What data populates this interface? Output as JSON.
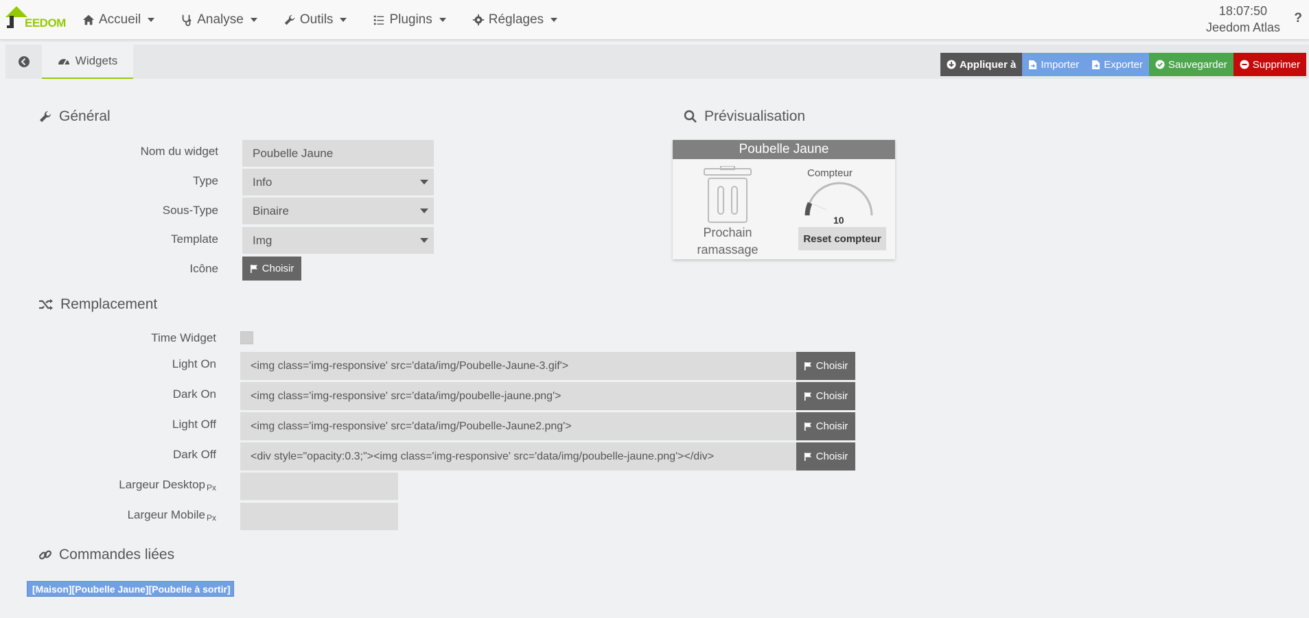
{
  "navbar": {
    "logo_text": "EEDOM",
    "menu": [
      {
        "label": "Accueil",
        "icon": "home-icon"
      },
      {
        "label": "Analyse",
        "icon": "stethoscope-icon"
      },
      {
        "label": "Outils",
        "icon": "wrench-icon"
      },
      {
        "label": "Plugins",
        "icon": "tasks-icon"
      },
      {
        "label": "Réglages",
        "icon": "gear-icon"
      }
    ],
    "clock": "18:07:50",
    "system_name": "Jeedom Atlas",
    "help": "?"
  },
  "tabs": {
    "active_label": "Widgets"
  },
  "actions": {
    "apply": "Appliquer à",
    "import": "Importer",
    "export": "Exporter",
    "save": "Sauvegarder",
    "delete": "Supprimer"
  },
  "general": {
    "title": "Général",
    "name_label": "Nom du widget",
    "name_value": "Poubelle Jaune",
    "type_label": "Type",
    "type_value": "Info",
    "subtype_label": "Sous-Type",
    "subtype_value": "Binaire",
    "template_label": "Template",
    "template_value": "Img",
    "icon_label": "Icône",
    "choose": "Choisir"
  },
  "preview": {
    "title": "Prévisualisation",
    "widget_title": "Poubelle Jaune",
    "label_line1": "Prochain",
    "label_line2": "ramassage",
    "counter_label": "Compteur",
    "counter_value": "10",
    "reset_button": "Reset compteur"
  },
  "replacement": {
    "title": "Remplacement",
    "time_widget_label": "Time Widget",
    "light_on_label": "Light On",
    "light_on_value": "<img class='img-responsive' src='data/img/Poubelle-Jaune-3.gif'>",
    "dark_on_label": "Dark On",
    "dark_on_value": "<img class='img-responsive' src='data/img/poubelle-jaune.png'>",
    "light_off_label": "Light Off",
    "light_off_value": "<img class='img-responsive' src='data/img/Poubelle-Jaune2.png'>",
    "dark_off_label": "Dark Off",
    "dark_off_value": "<div style=\"opacity:0.3;\"><img class='img-responsive' src='data/img/poubelle-jaune.png'></div>",
    "choose": "Choisir",
    "width_desktop_label": "Largeur Desktop",
    "width_mobile_label": "Largeur Mobile",
    "unit": "Px"
  },
  "linked": {
    "title": "Commandes liées",
    "command": "[Maison][Poubelle Jaune][Poubelle à sortir]"
  },
  "colors": {
    "brand": "#94ca02",
    "apply": "#555555",
    "import_export": "#72a0e5",
    "save": "#4da54d",
    "delete": "#c40a0a"
  }
}
